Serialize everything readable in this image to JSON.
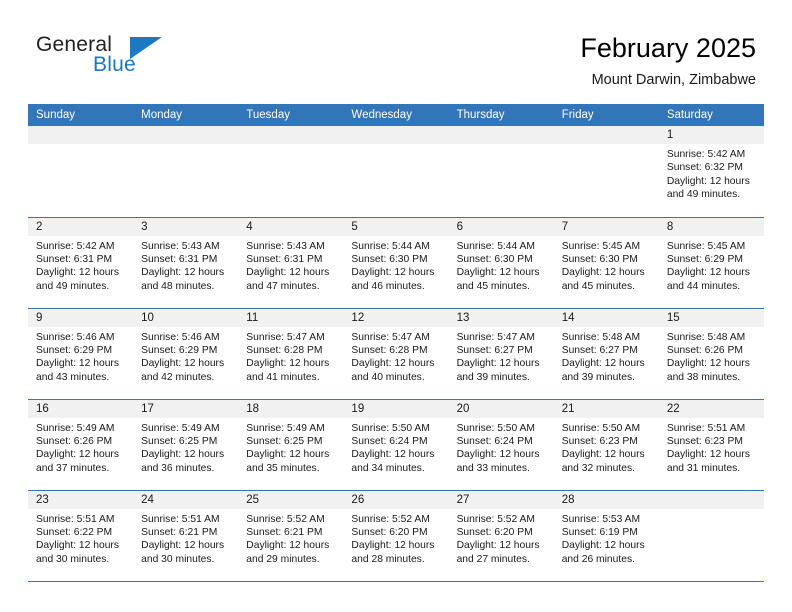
{
  "brand": {
    "name_top": "General",
    "name_bottom": "Blue",
    "triangle_icon": "blue-triangle-logo-mark",
    "color_text": "#231f20",
    "color_accent": "#1b79c4"
  },
  "header": {
    "title": "February 2025",
    "subtitle": "Mount Darwin, Zimbabwe"
  },
  "theme": {
    "header_row_bg": "#3275b8",
    "header_row_text": "#ffffff",
    "daynum_bg": "#f1f1f1",
    "grid_line": "#3275b8",
    "page_bg": "#ffffff"
  },
  "calendar": {
    "weekday_headers": [
      "Sunday",
      "Monday",
      "Tuesday",
      "Wednesday",
      "Thursday",
      "Friday",
      "Saturday"
    ],
    "labels": {
      "sunrise": "Sunrise:",
      "sunset": "Sunset:",
      "daylight": "Daylight:"
    },
    "weeks": [
      [
        {
          "day": "",
          "empty": true
        },
        {
          "day": "",
          "empty": true
        },
        {
          "day": "",
          "empty": true
        },
        {
          "day": "",
          "empty": true
        },
        {
          "day": "",
          "empty": true
        },
        {
          "day": "",
          "empty": true
        },
        {
          "day": "1",
          "sunrise": "Sunrise: 5:42 AM",
          "sunset": "Sunset: 6:32 PM",
          "daylight": "Daylight: 12 hours and 49 minutes."
        }
      ],
      [
        {
          "day": "2",
          "sunrise": "Sunrise: 5:42 AM",
          "sunset": "Sunset: 6:31 PM",
          "daylight": "Daylight: 12 hours and 49 minutes."
        },
        {
          "day": "3",
          "sunrise": "Sunrise: 5:43 AM",
          "sunset": "Sunset: 6:31 PM",
          "daylight": "Daylight: 12 hours and 48 minutes."
        },
        {
          "day": "4",
          "sunrise": "Sunrise: 5:43 AM",
          "sunset": "Sunset: 6:31 PM",
          "daylight": "Daylight: 12 hours and 47 minutes."
        },
        {
          "day": "5",
          "sunrise": "Sunrise: 5:44 AM",
          "sunset": "Sunset: 6:30 PM",
          "daylight": "Daylight: 12 hours and 46 minutes."
        },
        {
          "day": "6",
          "sunrise": "Sunrise: 5:44 AM",
          "sunset": "Sunset: 6:30 PM",
          "daylight": "Daylight: 12 hours and 45 minutes."
        },
        {
          "day": "7",
          "sunrise": "Sunrise: 5:45 AM",
          "sunset": "Sunset: 6:30 PM",
          "daylight": "Daylight: 12 hours and 45 minutes."
        },
        {
          "day": "8",
          "sunrise": "Sunrise: 5:45 AM",
          "sunset": "Sunset: 6:29 PM",
          "daylight": "Daylight: 12 hours and 44 minutes."
        }
      ],
      [
        {
          "day": "9",
          "sunrise": "Sunrise: 5:46 AM",
          "sunset": "Sunset: 6:29 PM",
          "daylight": "Daylight: 12 hours and 43 minutes."
        },
        {
          "day": "10",
          "sunrise": "Sunrise: 5:46 AM",
          "sunset": "Sunset: 6:29 PM",
          "daylight": "Daylight: 12 hours and 42 minutes."
        },
        {
          "day": "11",
          "sunrise": "Sunrise: 5:47 AM",
          "sunset": "Sunset: 6:28 PM",
          "daylight": "Daylight: 12 hours and 41 minutes."
        },
        {
          "day": "12",
          "sunrise": "Sunrise: 5:47 AM",
          "sunset": "Sunset: 6:28 PM",
          "daylight": "Daylight: 12 hours and 40 minutes."
        },
        {
          "day": "13",
          "sunrise": "Sunrise: 5:47 AM",
          "sunset": "Sunset: 6:27 PM",
          "daylight": "Daylight: 12 hours and 39 minutes."
        },
        {
          "day": "14",
          "sunrise": "Sunrise: 5:48 AM",
          "sunset": "Sunset: 6:27 PM",
          "daylight": "Daylight: 12 hours and 39 minutes."
        },
        {
          "day": "15",
          "sunrise": "Sunrise: 5:48 AM",
          "sunset": "Sunset: 6:26 PM",
          "daylight": "Daylight: 12 hours and 38 minutes."
        }
      ],
      [
        {
          "day": "16",
          "sunrise": "Sunrise: 5:49 AM",
          "sunset": "Sunset: 6:26 PM",
          "daylight": "Daylight: 12 hours and 37 minutes."
        },
        {
          "day": "17",
          "sunrise": "Sunrise: 5:49 AM",
          "sunset": "Sunset: 6:25 PM",
          "daylight": "Daylight: 12 hours and 36 minutes."
        },
        {
          "day": "18",
          "sunrise": "Sunrise: 5:49 AM",
          "sunset": "Sunset: 6:25 PM",
          "daylight": "Daylight: 12 hours and 35 minutes."
        },
        {
          "day": "19",
          "sunrise": "Sunrise: 5:50 AM",
          "sunset": "Sunset: 6:24 PM",
          "daylight": "Daylight: 12 hours and 34 minutes."
        },
        {
          "day": "20",
          "sunrise": "Sunrise: 5:50 AM",
          "sunset": "Sunset: 6:24 PM",
          "daylight": "Daylight: 12 hours and 33 minutes."
        },
        {
          "day": "21",
          "sunrise": "Sunrise: 5:50 AM",
          "sunset": "Sunset: 6:23 PM",
          "daylight": "Daylight: 12 hours and 32 minutes."
        },
        {
          "day": "22",
          "sunrise": "Sunrise: 5:51 AM",
          "sunset": "Sunset: 6:23 PM",
          "daylight": "Daylight: 12 hours and 31 minutes."
        }
      ],
      [
        {
          "day": "23",
          "sunrise": "Sunrise: 5:51 AM",
          "sunset": "Sunset: 6:22 PM",
          "daylight": "Daylight: 12 hours and 30 minutes."
        },
        {
          "day": "24",
          "sunrise": "Sunrise: 5:51 AM",
          "sunset": "Sunset: 6:21 PM",
          "daylight": "Daylight: 12 hours and 30 minutes."
        },
        {
          "day": "25",
          "sunrise": "Sunrise: 5:52 AM",
          "sunset": "Sunset: 6:21 PM",
          "daylight": "Daylight: 12 hours and 29 minutes."
        },
        {
          "day": "26",
          "sunrise": "Sunrise: 5:52 AM",
          "sunset": "Sunset: 6:20 PM",
          "daylight": "Daylight: 12 hours and 28 minutes."
        },
        {
          "day": "27",
          "sunrise": "Sunrise: 5:52 AM",
          "sunset": "Sunset: 6:20 PM",
          "daylight": "Daylight: 12 hours and 27 minutes."
        },
        {
          "day": "28",
          "sunrise": "Sunrise: 5:53 AM",
          "sunset": "Sunset: 6:19 PM",
          "daylight": "Daylight: 12 hours and 26 minutes."
        },
        {
          "day": "",
          "empty": true
        }
      ]
    ]
  }
}
